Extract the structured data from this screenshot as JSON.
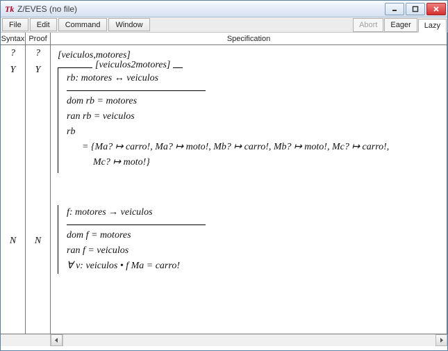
{
  "window": {
    "app_icon": "Tk",
    "title": "Z/EVES (no file)"
  },
  "menubar": {
    "items": [
      "File",
      "Edit",
      "Command",
      "Window"
    ]
  },
  "mode_tabs": {
    "abort": "Abort",
    "eager": "Eager",
    "lazy": "Lazy"
  },
  "columns": {
    "syntax": "Syntax",
    "proof": "Proof",
    "spec": "Specification"
  },
  "rows": [
    {
      "syntax": "?",
      "proof": "?"
    },
    {
      "syntax": "Y",
      "proof": "Y"
    },
    {
      "syntax": "N",
      "proof": "N"
    }
  ],
  "spec": {
    "given": "[veiculos,motores]",
    "schema1": {
      "name": "[veiculos2motores]",
      "decl": "rb: motores ↔ veiculos",
      "p1": "dom rb = motores",
      "p2": "ran rb = veiculos",
      "p3": "rb",
      "p4a": "= {Ma? ↦ carro!, Ma? ↦ moto!, Mb? ↦ carro!, Mb? ↦ moto!, Mc? ↦ carro!,",
      "p4b": "Mc? ↦ moto!}"
    },
    "axdef": {
      "decl": "f: motores → veiculos",
      "p1": "dom f = motores",
      "p2": "ran f = veiculos",
      "p3": "∀ v: veiculos • f Ma = carro!"
    }
  }
}
